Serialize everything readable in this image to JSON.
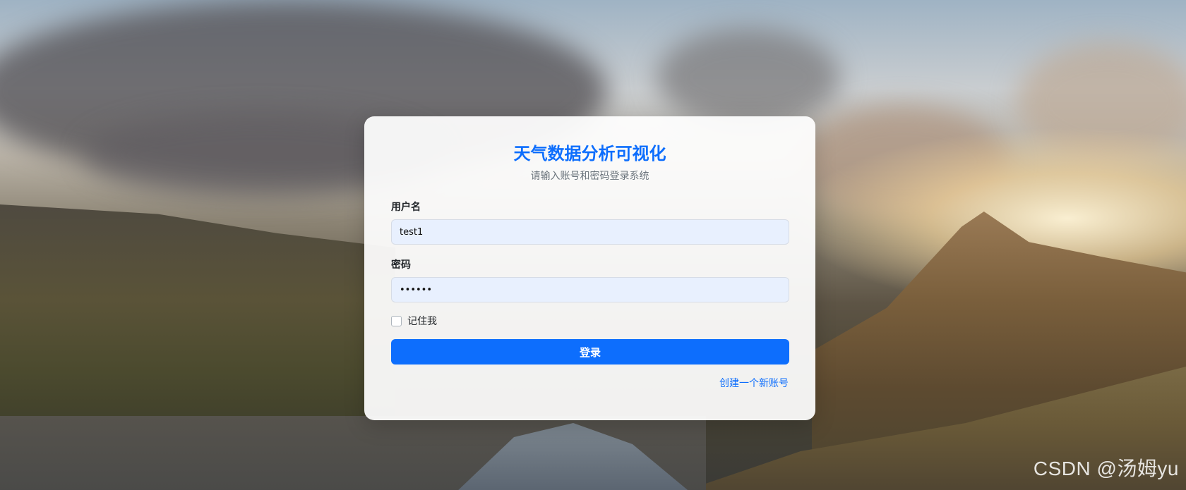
{
  "app": {
    "title": "天气数据分析可视化",
    "subtitle": "请输入账号和密码登录系统"
  },
  "form": {
    "username_label": "用户名",
    "username_value": "test1",
    "password_label": "密码",
    "password_value": "123456",
    "remember_label": "记住我",
    "remember_checked": false,
    "login_button": "登录",
    "register_link": "创建一个新账号"
  },
  "watermark": "CSDN @汤姆yu",
  "colors": {
    "accent": "#0d6efd",
    "input_bg": "#e8f0fe"
  }
}
